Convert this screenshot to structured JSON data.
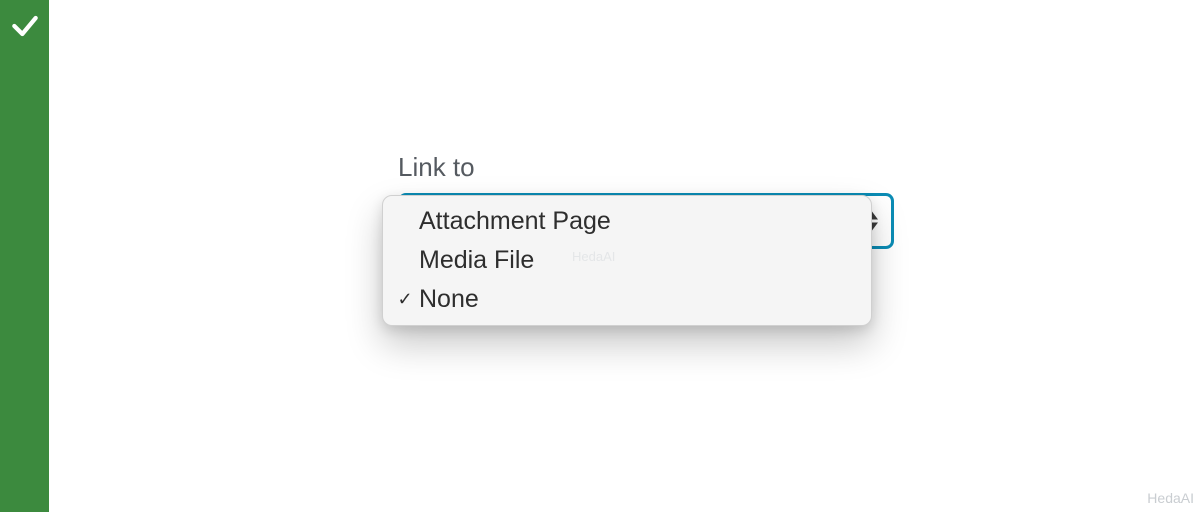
{
  "sidebar": {
    "icon": "check"
  },
  "field": {
    "label": "Link to",
    "options": [
      {
        "label": "Attachment Page",
        "selected": false
      },
      {
        "label": "Media File",
        "selected": false
      },
      {
        "label": "None",
        "selected": true
      }
    ]
  },
  "watermark": "HedaAI"
}
